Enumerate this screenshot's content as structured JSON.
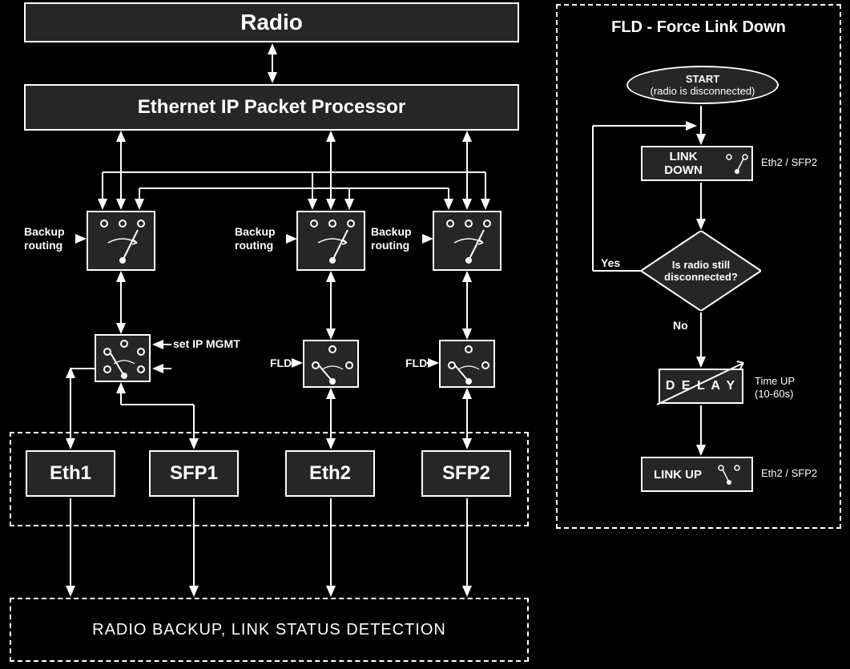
{
  "left": {
    "radio": "Radio",
    "processor": "Ethernet IP Packet Processor",
    "backup_routing": "Backup routing",
    "set_ip_mgmt": "set IP MGMT",
    "fld": "FLD",
    "ports": {
      "eth1": "Eth1",
      "sfp1": "SFP1",
      "eth2": "Eth2",
      "sfp2": "SFP2"
    },
    "footer": "RADIO BACKUP, LINK STATUS DETECTION"
  },
  "right": {
    "title": "FLD - Force Link Down",
    "start_line1": "START",
    "start_line2": "(radio is disconnected)",
    "link_down": "LINK DOWN",
    "link_down_port": "Eth2 / SFP2",
    "decision_line1": "Is radio still",
    "decision_line2": "disconnected?",
    "yes": "Yes",
    "no": "No",
    "delay": "D E L A Y",
    "delay_note_line1": "Time UP",
    "delay_note_line2": "(10-60s)",
    "link_up": "LINK UP",
    "link_up_port": "Eth2 / SFP2"
  }
}
